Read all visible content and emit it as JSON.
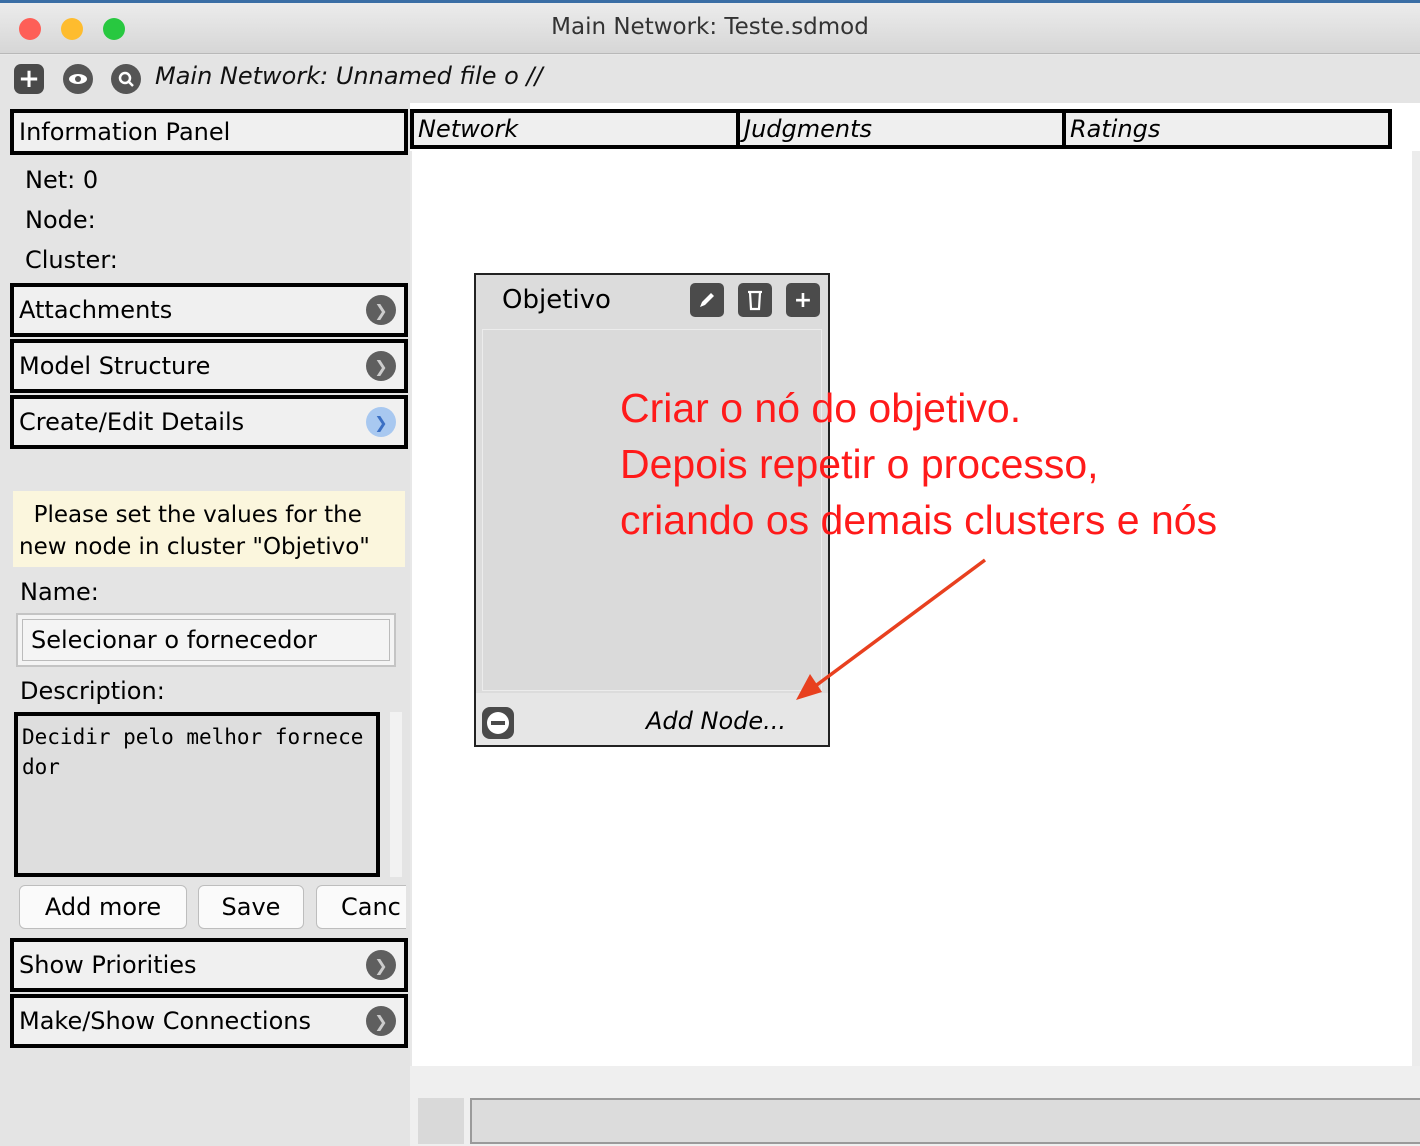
{
  "window": {
    "title": "Main Network: Teste.sdmod",
    "traffic_lights": {
      "close": "#fe5f57",
      "minimize": "#febc2e",
      "zoom": "#28c840"
    }
  },
  "toolbar": {
    "add_icon": "plus-icon",
    "view_icon": "eye-icon",
    "zoom_icon": "magnifier-icon",
    "label": "Main Network: Unnamed file o //"
  },
  "tabs": [
    {
      "label": "Network"
    },
    {
      "label": "Judgments"
    },
    {
      "label": "Ratings"
    }
  ],
  "left_panel": {
    "information_panel": "Information Panel",
    "net": "Net: 0",
    "node": "Node:",
    "cluster": "Cluster:",
    "attachments": "Attachments",
    "model_structure": "Model Structure",
    "create_edit": "Create/Edit Details",
    "notice_line1": "  Please set the values for the",
    "notice_line2": "new node in cluster \"Objetivo\"",
    "name_label": "Name:",
    "name_value": "Selecionar o fornecedor",
    "description_label": "Description:",
    "description_value": "Decidir pelo melhor fornecedor",
    "add_more": "Add more",
    "save": "Save",
    "cancel": "Canc",
    "show_priorities": "Show Priorities",
    "make_show_connections": "Make/Show Connections"
  },
  "cluster": {
    "title": "Objetivo",
    "edit_icon": "pencil-icon",
    "delete_icon": "trash-icon",
    "add_icon": "plus-icon",
    "add_node": "Add Node..."
  },
  "annotation": {
    "line1": "Criar o nó do objetivo.",
    "line2": "Depois repetir o processo,",
    "line3": "criando os demais clusters e nós",
    "color": "#ff1a1a"
  }
}
